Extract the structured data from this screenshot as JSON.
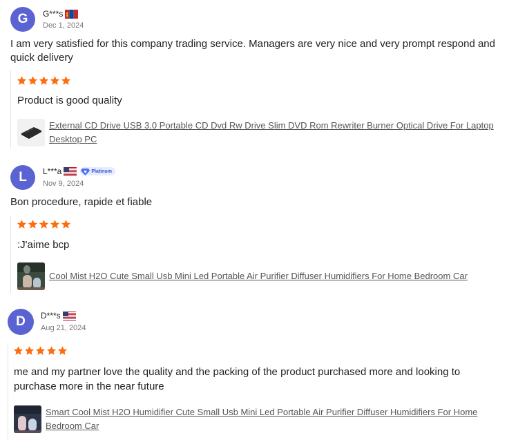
{
  "reviews": [
    {
      "avatar_letter": "G",
      "name": "G***s",
      "flag": "mongolia-flag",
      "date": "Dec 1, 2024",
      "comment": "I am very satisfied for this company trading service. Managers are very nice and very prompt respond and quick delivery",
      "rating": 5,
      "additional_text": "Product is good quality",
      "product_title": "External CD Drive USB 3.0 Portable CD Dvd Rw Drive Slim DVD Rom Rewriter Burner Optical Drive For Laptop Desktop PC",
      "product_icon": "cd-drive-thumbnail"
    },
    {
      "avatar_letter": "L",
      "name": "L***a",
      "flag": "us-flag",
      "badge": "Platinum",
      "date": "Nov 9, 2024",
      "comment": "Bon procedure, rapide et fiable",
      "rating": 5,
      "additional_text": ":J'aime bcp",
      "product_title": "Cool Mist H2O Cute Small Usb Mini Led Portable Air Purifier Diffuser Humidifiers For Home Bedroom Car",
      "product_icon": "humidifier-thumbnail"
    },
    {
      "avatar_letter": "D",
      "name": "D***s",
      "flag": "us-flag",
      "date": "Aug 21, 2024",
      "comment": "",
      "rating": 5,
      "additional_text": "me and my partner love the quality and the packing of the product purchased more and looking to purchase more in the near future",
      "product_title": "Smart Cool Mist H2O Humidifier Cute Small Usb Mini Led Portable Air Purifier Diffuser Humidifiers For Home Bedroom Car",
      "product_icon": "humidifier-thumbnail"
    }
  ],
  "colors": {
    "avatar": "#5b63d3",
    "star": "#fd6d0f",
    "link": "#555555",
    "date": "#777777"
  }
}
